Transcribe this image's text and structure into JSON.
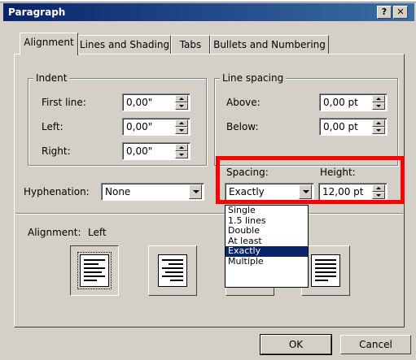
{
  "dialog": {
    "title": "Paragraph",
    "help_button": "?",
    "close_button": "✕"
  },
  "tabs": [
    {
      "label": "Alignment",
      "active": true
    },
    {
      "label": "Lines and Shading",
      "active": false
    },
    {
      "label": "Tabs",
      "active": false
    },
    {
      "label": "Bullets and Numbering",
      "active": false
    }
  ],
  "indent": {
    "legend": "Indent",
    "first_line": {
      "label": "First line:",
      "value": "0,00\""
    },
    "left": {
      "label": "Left:",
      "value": "0,00\""
    },
    "right": {
      "label": "Right:",
      "value": "0,00\""
    }
  },
  "line_spacing": {
    "legend": "Line spacing",
    "above": {
      "label": "Above:",
      "value": "0,00 pt"
    },
    "below": {
      "label": "Below:",
      "value": "0,00 pt"
    },
    "spacing": {
      "label": "Spacing:",
      "value": "Exactly"
    },
    "height": {
      "label": "Height:",
      "value": "12,00 pt"
    },
    "options": [
      "Single",
      "1.5 lines",
      "Double",
      "At least",
      "Exactly",
      "Multiple"
    ],
    "selected_index": 4
  },
  "hyphenation": {
    "label": "Hyphenation:",
    "value": "None"
  },
  "alignment": {
    "label": "Alignment:",
    "value": "Left"
  },
  "buttons": {
    "ok": "OK",
    "cancel": "Cancel"
  },
  "colors": {
    "titlebar": "#0a246a",
    "highlight_box": "#ff0000",
    "selection": "#0a246a"
  }
}
